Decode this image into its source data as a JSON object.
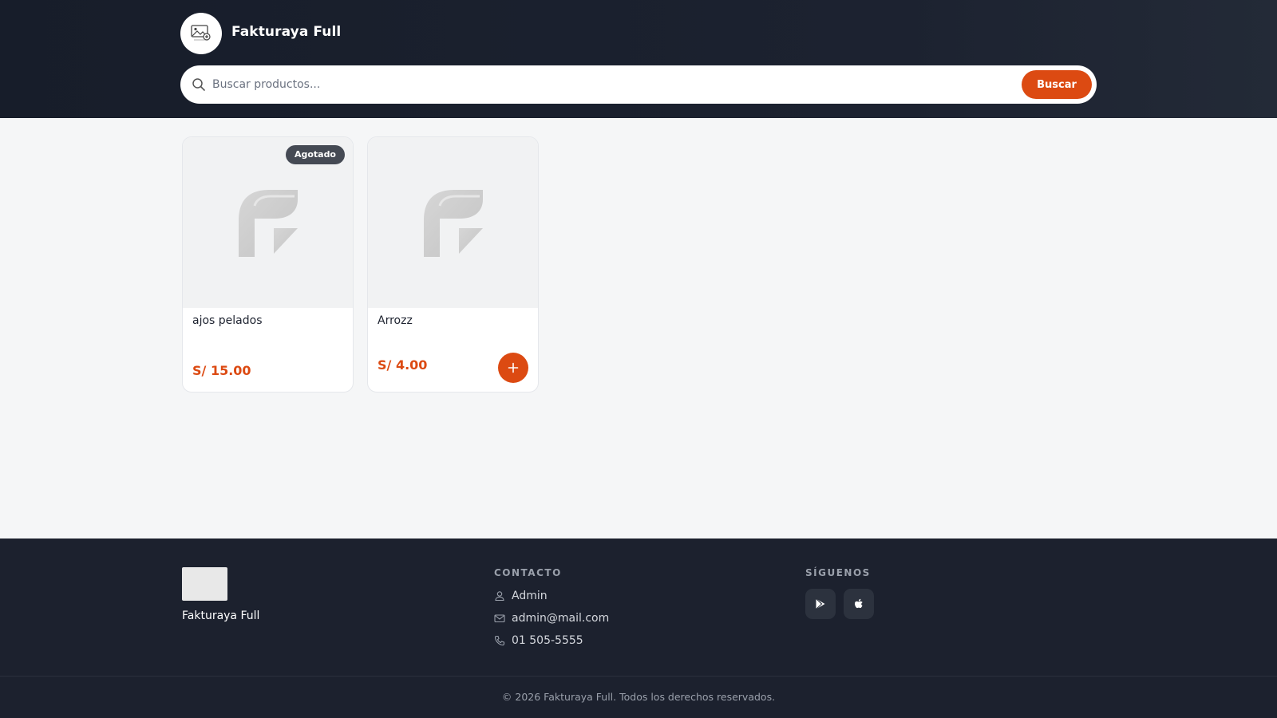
{
  "header": {
    "brand_name": "Fakturaya Full",
    "search": {
      "placeholder": "Buscar productos...",
      "value": "",
      "button_label": "Buscar",
      "icon": "search-icon"
    }
  },
  "products": [
    {
      "name": "ajos pelados",
      "price": "S/ 15.00",
      "badge": "Agotado",
      "image_icon": "placeholder-logo-icon"
    },
    {
      "name": "Arrozz",
      "price": "S/ 4.00",
      "add_icon": "plus-icon",
      "image_icon": "placeholder-logo-icon"
    }
  ],
  "footer": {
    "brand_name": "Fakturaya Full",
    "contact": {
      "heading": "CONTACTO",
      "user": "Admin",
      "email": "admin@mail.com",
      "phone": "01 505-5555"
    },
    "social": {
      "heading": "SÍGUENOS",
      "items": [
        "google-play-icon",
        "apple-icon"
      ]
    },
    "copyright": "© 2026 Fakturaya Full. Todos los derechos reservados."
  },
  "colors": {
    "accent": "#dc4a12",
    "header_bg": "#1c2230",
    "footer_bg": "#1c212e",
    "badge_bg": "#454a54",
    "page_bg": "#f5f6f7"
  }
}
